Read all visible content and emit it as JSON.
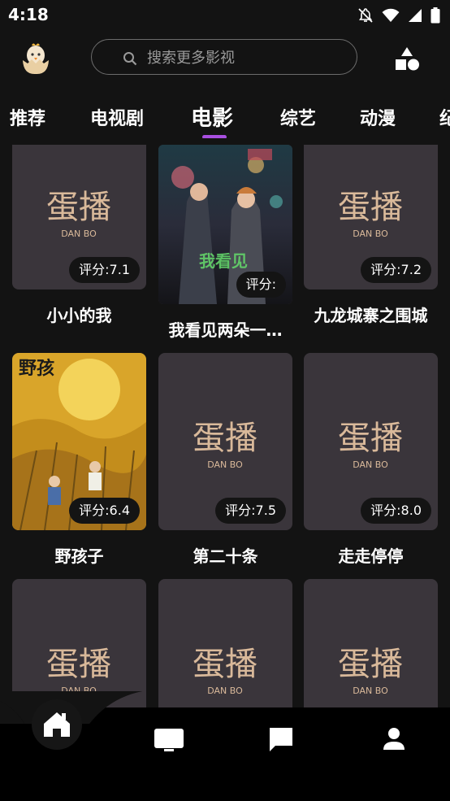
{
  "status": {
    "time": "4:18"
  },
  "header": {
    "search_placeholder": "搜索更多影视",
    "logo_icon": "chick-in-egg-icon",
    "category_icon": "shapes-category-icon"
  },
  "tabs": [
    {
      "label": "推荐",
      "active": false
    },
    {
      "label": "电视剧",
      "active": false
    },
    {
      "label": "电影",
      "active": true
    },
    {
      "label": "综艺",
      "active": false
    },
    {
      "label": "动漫",
      "active": false
    },
    {
      "label": "纪",
      "active": false
    }
  ],
  "placeholder_brand": {
    "cn": "蛋播",
    "en": "DAN BO"
  },
  "movies": [
    {
      "title": "小小的我",
      "rating": "评分:7.1",
      "poster": "placeholder"
    },
    {
      "title": "我看见两朵一…",
      "rating": "评分:",
      "poster": "city-night"
    },
    {
      "title": "九龙城寨之围城",
      "rating": "评分:7.2",
      "poster": "placeholder"
    },
    {
      "title": "野孩子",
      "rating": "评分:6.4",
      "poster": "yellow-field"
    },
    {
      "title": "第二十条",
      "rating": "评分:7.5",
      "poster": "placeholder"
    },
    {
      "title": "走走停停",
      "rating": "评分:8.0",
      "poster": "placeholder"
    },
    {
      "title": "",
      "rating": "",
      "poster": "placeholder"
    },
    {
      "title": "",
      "rating": "",
      "poster": "placeholder"
    },
    {
      "title": "",
      "rating": "",
      "poster": "placeholder"
    }
  ],
  "bottom_nav": [
    {
      "icon": "home-icon",
      "active": true
    },
    {
      "icon": "tv-icon",
      "active": false
    },
    {
      "icon": "message-icon",
      "active": false
    },
    {
      "icon": "person-icon",
      "active": false
    }
  ],
  "colors": {
    "accent": "#a84fe0",
    "background": "#131313",
    "card": "#3a353b",
    "brand_text": "#d9b99a"
  }
}
